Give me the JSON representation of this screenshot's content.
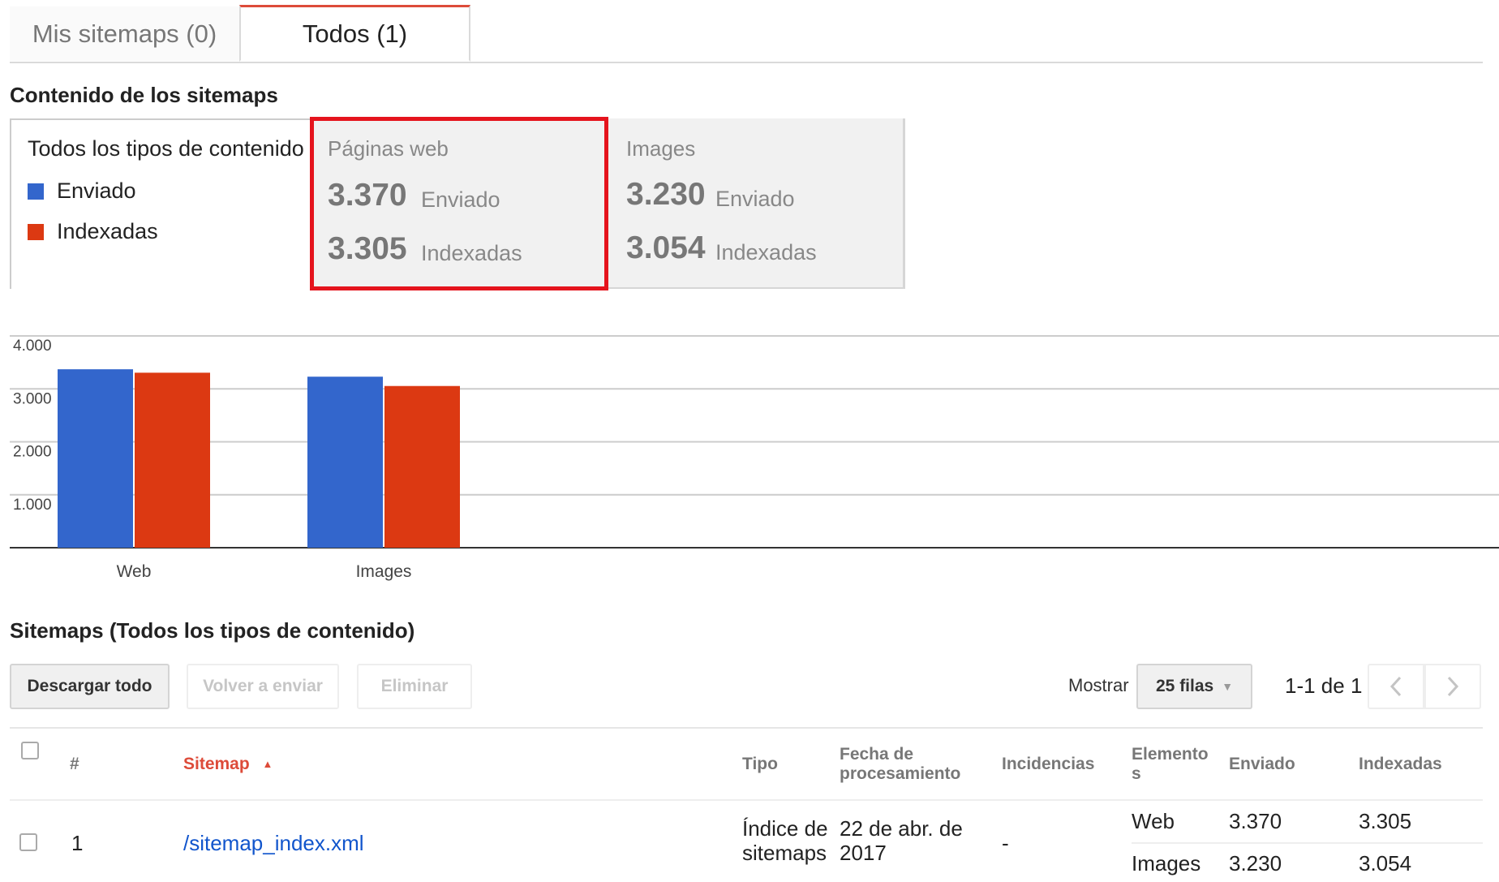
{
  "tabs": [
    {
      "label": "Mis sitemaps (0)",
      "active": false
    },
    {
      "label": "Todos (1)",
      "active": true
    }
  ],
  "content_section": {
    "title": "Contenido de los sitemaps",
    "legend": {
      "title": "Todos los tipos de contenido",
      "items": [
        {
          "label": "Enviado",
          "color": "#3366cc"
        },
        {
          "label": "Indexadas",
          "color": "#dc3912"
        }
      ]
    },
    "cards": [
      {
        "name": "Páginas web",
        "submitted": "3.370",
        "submitted_label": "Enviado",
        "indexed": "3.305",
        "indexed_label": "Indexadas",
        "highlighted": true
      },
      {
        "name": "Images",
        "submitted": "3.230",
        "submitted_label": "Enviado",
        "indexed": "3.054",
        "indexed_label": "Indexadas",
        "highlighted": false
      }
    ]
  },
  "chart_data": {
    "type": "bar",
    "categories": [
      "Web",
      "Images"
    ],
    "series": [
      {
        "name": "Enviado",
        "color": "#3366cc",
        "values": [
          3370,
          3230
        ]
      },
      {
        "name": "Indexadas",
        "color": "#dc3912",
        "values": [
          3305,
          3054
        ]
      }
    ],
    "y_ticks": [
      "1.000",
      "2.000",
      "3.000",
      "4.000"
    ],
    "y_tick_values": [
      1000,
      2000,
      3000,
      4000
    ],
    "ylim": [
      0,
      4000
    ],
    "grid": true,
    "legend": "none"
  },
  "sitemaps_section": {
    "title": "Sitemaps (Todos los tipos de contenido)",
    "buttons": {
      "download": "Descargar todo",
      "resubmit": "Volver a enviar",
      "delete": "Eliminar"
    },
    "pagination": {
      "show_label": "Mostrar",
      "rows_option": "25 filas",
      "range": "1-1 de 1"
    },
    "table": {
      "headers": {
        "number": "#",
        "sitemap": "Sitemap",
        "type": "Tipo",
        "processed_date": "Fecha de procesamiento",
        "issues": "Incidencias",
        "items": "Elementos",
        "submitted": "Enviado",
        "indexed": "Indexadas"
      },
      "rows": [
        {
          "number": "1",
          "sitemap": "/sitemap_index.xml",
          "type": "Índice de sitemaps",
          "processed_date": "22 de abr. de 2017",
          "issues": "-",
          "items": [
            {
              "name": "Web",
              "submitted": "3.370",
              "indexed": "3.305"
            },
            {
              "name": "Images",
              "submitted": "3.230",
              "indexed": "3.054"
            }
          ]
        }
      ]
    }
  }
}
